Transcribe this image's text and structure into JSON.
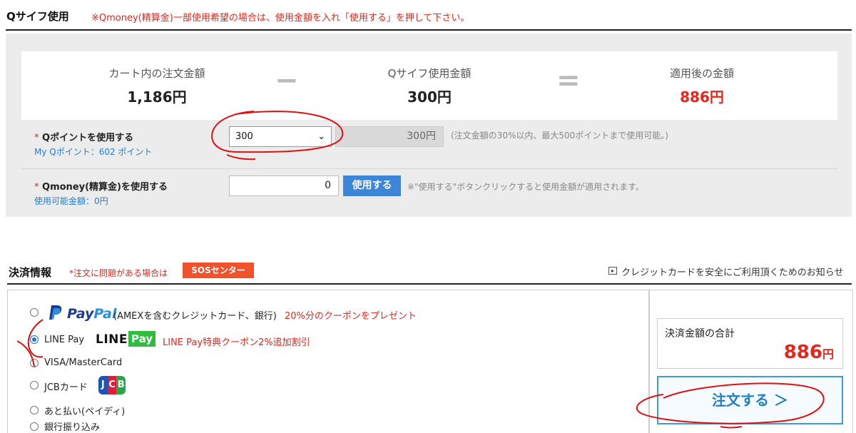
{
  "qsaif": {
    "title": "Qサイフ使用",
    "note": "※Qmoney(精算金)一部使用希望の場合は、使用金額を入れ「使用する」を押して下さい。",
    "summary": {
      "cart_label": "カート内の注文金額",
      "cart_value": "1,186円",
      "minus_symbol": "−",
      "use_label": "Qサイフ使用金額",
      "use_value": "300円",
      "equals_symbol": "=",
      "after_label": "適用後の金額",
      "after_value": "886円"
    },
    "qpoint": {
      "star": "*",
      "label": "Qポイントを使用する",
      "sub": "My Qポイント：602 ポイント",
      "selected": "300",
      "amount": "300円",
      "hint": "(注文金額の30%以内、最大500ポイントまで使用可能。)"
    },
    "qmoney": {
      "star": "*",
      "label": "Qmoney(精算金)を使用する",
      "sub": "使用可能金額：0円",
      "value": "0",
      "button": "使用する",
      "hint": "※\"使用する\"ボタンクリックすると使用金額が適用されます。"
    }
  },
  "payment": {
    "title": "決済情報",
    "note": "*注文に問題がある場合は",
    "sos": "SOSセンター",
    "info_link": "クレジットカードを安全にご利用頂くためのお知らせ",
    "options": {
      "paypal": {
        "brand_a": "Pay",
        "brand_b": "Pal",
        "label": "(AMEXを含むクレジットカード、銀行)",
        "promo": "20%分のクーポンをプレゼント"
      },
      "linepay": {
        "label": "LINE Pay",
        "logo_line": "LINE",
        "logo_pay": "Pay",
        "promo": "LINE Pay特典クーポン2%追加割引"
      },
      "visa": {
        "label": "VISA/MasterCard"
      },
      "jcb": {
        "label": "JCBカード",
        "logo_j": "J",
        "logo_c": "C",
        "logo_b": "B"
      },
      "paidy": {
        "label": "あと払い(ペイディ)"
      },
      "bank": {
        "label": "銀行振り込み"
      }
    },
    "total_label": "決済金額の合計",
    "total_value": "886",
    "total_unit": "円",
    "order_button": "注文する ＞"
  },
  "colors": {
    "accent_red": "#e8251c",
    "link_blue": "#2a7cd1",
    "button_blue": "#3b86d8",
    "line_green": "#2ebd3c",
    "annotation": "#e01010"
  }
}
